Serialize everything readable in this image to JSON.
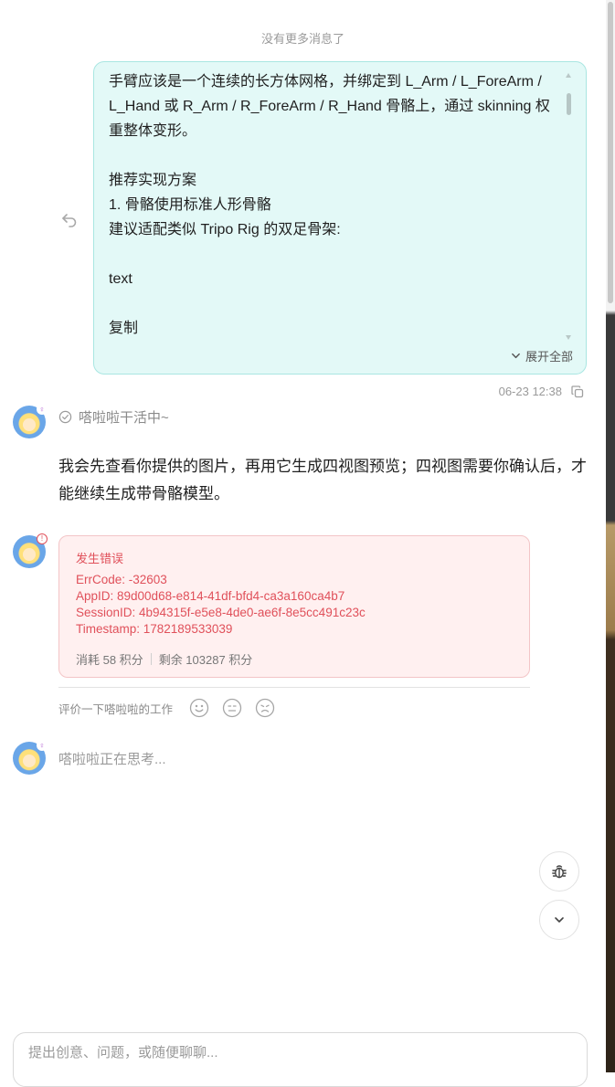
{
  "conversation": {
    "no_more_messages": "没有更多消息了"
  },
  "user_message": {
    "text": "手臂应该是一个连续的长方体网格，并绑定到 L_Arm / L_ForeArm / L_Hand 或 R_Arm / R_ForeArm / R_Hand 骨骼上，通过 skinning 权重整体变形。\n\n推荐实现方案\n1. 骨骼使用标准人形骨骼\n建议适配类似 Tripo Rig 的双足骨架:\n\ntext\n\n复制",
    "expand_label": "展开全部",
    "timestamp": "06-23 12:38"
  },
  "assistant": {
    "status": "嗒啦啦干活中~",
    "reply": "我会先查看你提供的图片，再用它生成四视图预览；四视图需要你确认后，才能继续生成带骨骼模型。"
  },
  "error": {
    "title": "发生错误",
    "err_code": "ErrCode: -32603",
    "app_id": "AppID: 89d00d68-e814-41df-bfd4-ca3a160ca4b7",
    "session_id": "SessionID: 4b94315f-e5e8-4de0-ae6f-8e5cc491c23c",
    "timestamp": "Timestamp: 1782189533039",
    "cost": "消耗 58 积分",
    "remaining": "剩余 103287 积分"
  },
  "rating": {
    "prompt": "评价一下嗒啦啦的工作",
    "icons": [
      "smile-icon",
      "neutral-face-icon",
      "frown-icon"
    ]
  },
  "thinking": {
    "text": "嗒啦啦正在思考..."
  },
  "input": {
    "placeholder": "提出创意、问题，或随便聊聊..."
  },
  "colors": {
    "user_bubble_bg": "#e3f9f7",
    "user_bubble_border": "#a9e6e2",
    "error_bg": "#fff0f0",
    "error_text": "#e0505a"
  }
}
